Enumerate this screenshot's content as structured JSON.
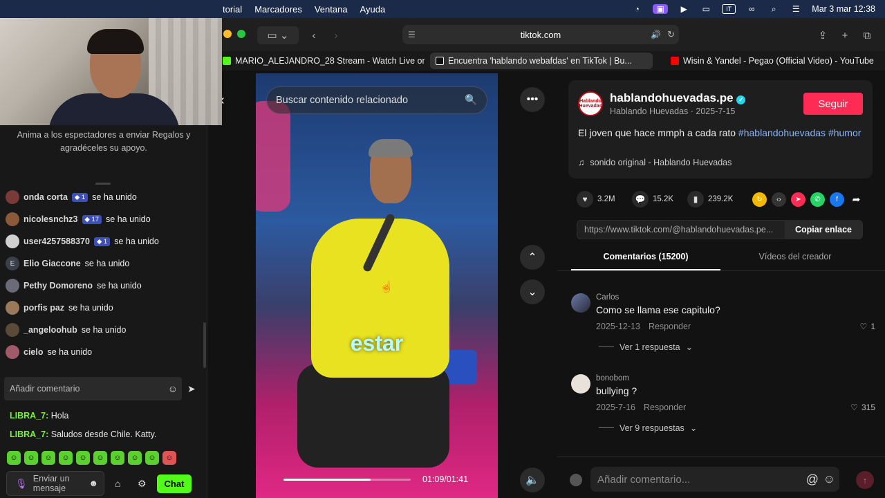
{
  "menubar": {
    "items": [
      "torial",
      "Marcadores",
      "Ventana",
      "Ayuda"
    ],
    "datetime": "Mar 3 mar 12:38",
    "input_source": "IT"
  },
  "safari": {
    "address": "tiktok.com",
    "tabs": [
      {
        "label": "MARIO_ALEJANDRO_28 Stream - Watch Live on...",
        "icon_color": "#53fc18"
      },
      {
        "label": "Encuentra 'hablando webafdas' en TikTok | Bu...",
        "icon_color": "#ffffff"
      },
      {
        "label": "Wisin & Yandel - Pegao (Official Video) - YouTube",
        "icon_color": "#ff0000"
      }
    ]
  },
  "stream": {
    "hint": "Anima a los espectadores a enviar Regalos y agradéceles su apoyo.",
    "joins": [
      {
        "name": "onda corta",
        "badge": "1",
        "text": "se ha unido"
      },
      {
        "name": "nicolesnchz3",
        "badge": "17",
        "text": "se ha unido"
      },
      {
        "name": "user4257588370",
        "badge": "1",
        "text": "se ha unido"
      },
      {
        "name": "Elio Giaccone",
        "badge": "",
        "text": "se ha unido",
        "initial": "E"
      },
      {
        "name": "Pethy Domoreno",
        "badge": "",
        "text": "se ha unido"
      },
      {
        "name": "porfis paz",
        "badge": "",
        "text": "se ha unido"
      },
      {
        "name": "_angeloohub",
        "badge": "",
        "text": "se ha unido"
      },
      {
        "name": "cielo",
        "badge": "",
        "text": "se ha unido"
      }
    ],
    "add_comment_placeholder": "Añadir comentario",
    "chat": [
      {
        "user": "LIBRA_7:",
        "text": "Hola"
      },
      {
        "user": "LIBRA_7:",
        "text": "Saludos desde Chile. Katty."
      }
    ],
    "send_placeholder_line1": "Enviar un",
    "send_placeholder_line2": "mensaje",
    "chat_button": "Chat",
    "accent": "#53fc18"
  },
  "video": {
    "search_placeholder": "Buscar contenido relacionado",
    "caption_word": "estar",
    "time": "01:09/01:41",
    "progress_fraction": 0.683
  },
  "post": {
    "username": "hablandohuevadas.pe",
    "avatar_text": "Hablando Huevadas",
    "display_name": "Hablando Huevadas",
    "date": "2025-7-15",
    "follow_label": "Seguir",
    "description": "El joven que hace mmph a cada rato",
    "hashtag1": "#hablandohuevadas",
    "hashtag2": "#humor",
    "sound": "sonido original - Hablando Huevadas",
    "likes": "3.2M",
    "comments": "15.2K",
    "saves": "239.2K",
    "link": "https://www.tiktok.com/@hablandohuevadas.pe...",
    "copy_link": "Copiar enlace",
    "tab_comments": "Comentarios (15200)",
    "tab_creator": "Vídeos del creador",
    "brand_color": "#fe2c55"
  },
  "comments": [
    {
      "user": "Carlos",
      "text": "Como se llama ese capitulo?",
      "date": "2025-12-13",
      "reply": "Responder",
      "likes": "1",
      "replies": "Ver 1 respuesta"
    },
    {
      "user": "bonobom",
      "text": "bullying ?",
      "date": "2025-7-16",
      "reply": "Responder",
      "likes": "315",
      "replies": "Ver 9 respuestas"
    }
  ],
  "comment_input_placeholder": "Añadir comentario..."
}
